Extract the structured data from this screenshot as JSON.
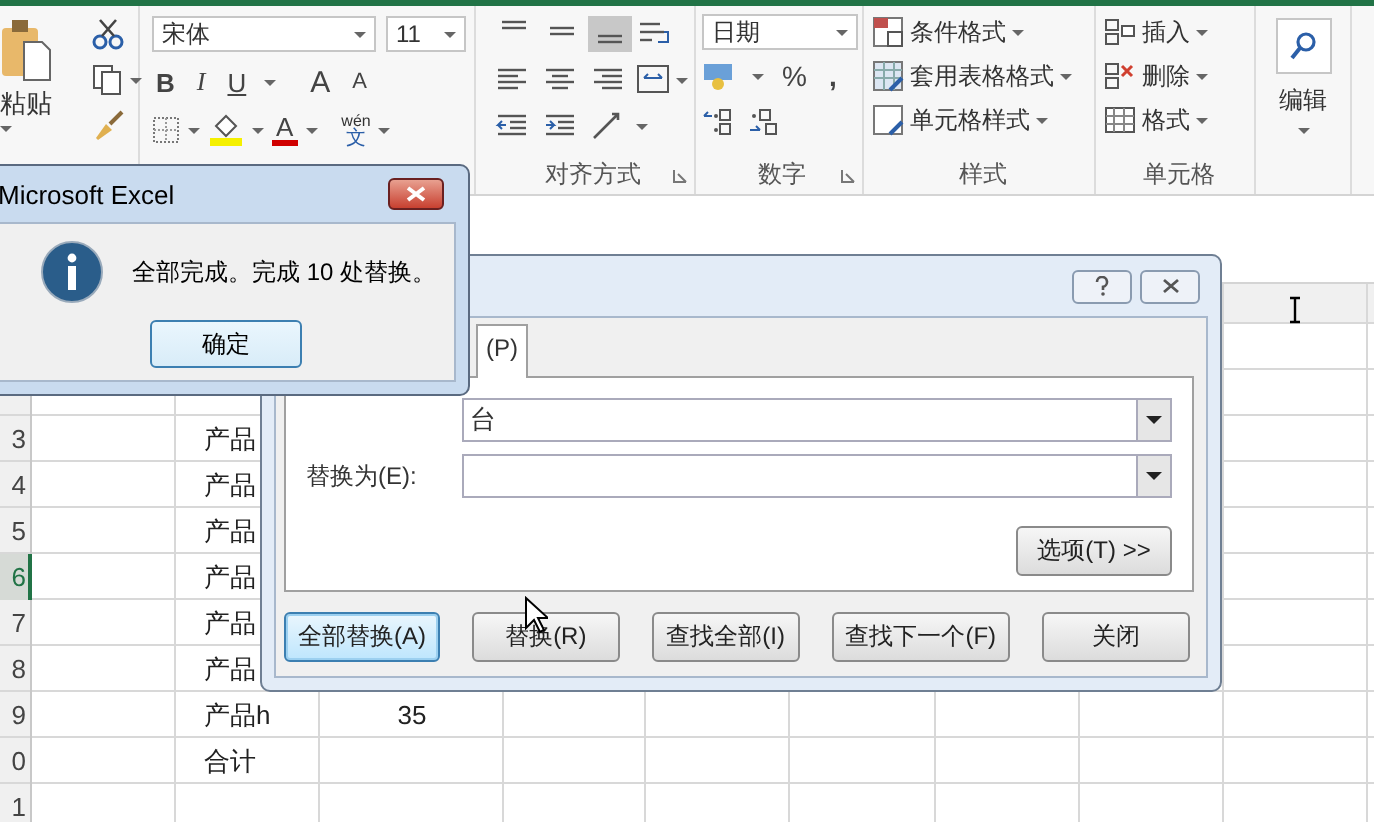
{
  "ribbon": {
    "clipboard": {
      "paste": "粘贴"
    },
    "font": {
      "font_name": "宋体",
      "font_size": "11",
      "bold": "B",
      "italic": "I",
      "underline": "U",
      "grow": "A",
      "shrink": "A",
      "font_color": "A",
      "phonetic_top": "wén",
      "phonetic_char": "文"
    },
    "alignment": {
      "vertical": [
        {
          "selected": false
        },
        {
          "selected": false
        },
        {
          "selected": true
        }
      ],
      "label": "对齐方式"
    },
    "number": {
      "format": "日期",
      "percent": "%",
      "comma": ",",
      "label": "数字"
    },
    "styles": {
      "commands": [
        "条件格式",
        "套用表格格式",
        "单元格样式"
      ],
      "label": "样式"
    },
    "cells": {
      "commands": [
        "插入",
        "删除",
        "格式"
      ],
      "label": "单元格"
    },
    "editing": {
      "label": "编辑"
    }
  },
  "sheet": {
    "rows": [
      {
        "header": "3",
        "selected": false,
        "column_b": "产品"
      },
      {
        "header": "4",
        "selected": false,
        "column_b": "产品"
      },
      {
        "header": "5",
        "selected": false,
        "column_b": "产品"
      },
      {
        "header": "6",
        "selected": true,
        "column_b": "产品"
      },
      {
        "header": "7",
        "selected": false,
        "column_b": "产品"
      },
      {
        "header": "8",
        "selected": false,
        "column_b": "产品"
      },
      {
        "header": "9",
        "selected": false,
        "column_b": "产品h",
        "column_c": "35"
      },
      {
        "header": "0",
        "selected": false,
        "column_b": "合计"
      },
      {
        "header": "1",
        "selected": false
      }
    ]
  },
  "message_box": {
    "title": "Microsoft Excel",
    "message": "全部完成。完成 10 处替换。",
    "button": "确定"
  },
  "find_replace": {
    "tab": "(P)",
    "find_value": "台",
    "replace_label": "替换为(E):",
    "options_button": "选项(T) >>",
    "buttons": [
      {
        "label": "全部替换(A)",
        "default": true
      },
      {
        "label": "替换(R)",
        "default": false
      },
      {
        "label": "查找全部(I)",
        "default": false
      },
      {
        "label": "查找下一个(F)",
        "default": false
      },
      {
        "label": "关闭",
        "default": false
      }
    ]
  }
}
